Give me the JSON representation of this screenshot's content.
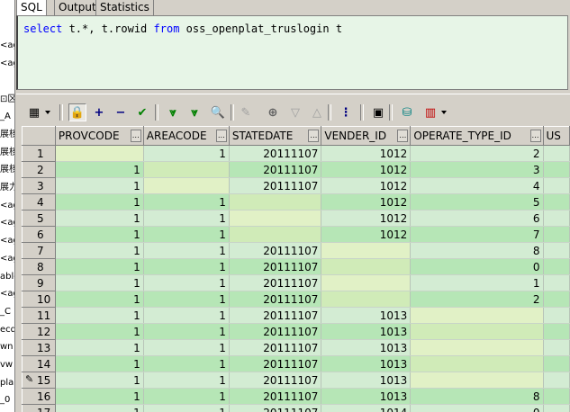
{
  "left_panel": {
    "items": [
      "",
      "",
      "<ag",
      "<ag",
      "",
      "⊡区",
      "_A",
      "展核",
      "展核",
      "展核",
      "展力",
      "<ag",
      "<ag",
      "<ag",
      "<ag",
      "able",
      "<ag",
      "_C",
      "ecd",
      "wn",
      "vw",
      "pla",
      "_0"
    ]
  },
  "tabs": [
    {
      "label": "SQL",
      "active": true
    },
    {
      "label": "Output",
      "active": false
    },
    {
      "label": "Statistics",
      "active": false
    }
  ],
  "editor": {
    "tokens": [
      {
        "text": "select",
        "kw": true
      },
      {
        "text": " t.*, t.rowid ",
        "kw": false
      },
      {
        "text": "from",
        "kw": true
      },
      {
        "text": " oss_openplat_truslogin t",
        "kw": false
      }
    ]
  },
  "toolbar": {
    "buttons": [
      {
        "icon": "grid-select-icon",
        "glyph": "▦",
        "color": "#000000",
        "dropdown": true
      },
      {
        "icon": "lock-icon",
        "glyph": "🔒",
        "color": "#806000",
        "pressed": true
      },
      {
        "icon": "insert-record-icon",
        "glyph": "+",
        "color": "#000080"
      },
      {
        "icon": "delete-record-icon",
        "glyph": "−",
        "color": "#000080"
      },
      {
        "icon": "post-changes-icon",
        "glyph": "✔",
        "color": "#008000"
      },
      {
        "icon": "fetch-next-icon",
        "glyph": "⩔",
        "color": "#008000"
      },
      {
        "icon": "fetch-last-icon",
        "glyph": "⩔",
        "color": "#008000"
      },
      {
        "icon": "find-icon",
        "glyph": "🔍",
        "color": "#000000"
      },
      {
        "icon": "clear-icon",
        "glyph": "✎",
        "color": "#a0a0a0"
      },
      {
        "icon": "query-by-example-icon",
        "glyph": "⊕",
        "color": "#606060"
      },
      {
        "icon": "sort-down-icon",
        "glyph": "▽",
        "color": "#a0a0a0"
      },
      {
        "icon": "sort-up-icon",
        "glyph": "△",
        "color": "#a0a0a0"
      },
      {
        "icon": "tree-view-icon",
        "glyph": "⋮",
        "color": "#000080"
      },
      {
        "icon": "save-icon",
        "glyph": "▣",
        "color": "#000000"
      },
      {
        "icon": "database-icon",
        "glyph": "⛁",
        "color": "#008080"
      },
      {
        "icon": "chart-icon",
        "glyph": "▥",
        "color": "#c00000",
        "dropdown": true
      }
    ]
  },
  "grid": {
    "columns": [
      "PROVCODE",
      "AREACODE",
      "STATEDATE",
      "VENDER_ID",
      "OPERATE_TYPE_ID",
      "US"
    ],
    "rows": [
      {
        "n": "1",
        "cells": [
          "",
          "1",
          "20111107",
          "1012",
          "2",
          ""
        ]
      },
      {
        "n": "2",
        "cells": [
          "1",
          "",
          "20111107",
          "1012",
          "3",
          ""
        ]
      },
      {
        "n": "3",
        "cells": [
          "1",
          "",
          "20111107",
          "1012",
          "4",
          ""
        ]
      },
      {
        "n": "4",
        "cells": [
          "1",
          "1",
          "",
          "1012",
          "5",
          ""
        ]
      },
      {
        "n": "5",
        "cells": [
          "1",
          "1",
          "",
          "1012",
          "6",
          ""
        ]
      },
      {
        "n": "6",
        "cells": [
          "1",
          "1",
          "",
          "1012",
          "7",
          ""
        ]
      },
      {
        "n": "7",
        "cells": [
          "1",
          "1",
          "20111107",
          "",
          "8",
          ""
        ]
      },
      {
        "n": "8",
        "cells": [
          "1",
          "1",
          "20111107",
          "",
          "0",
          ""
        ]
      },
      {
        "n": "9",
        "cells": [
          "1",
          "1",
          "20111107",
          "",
          "1",
          ""
        ]
      },
      {
        "n": "10",
        "cells": [
          "1",
          "1",
          "20111107",
          "",
          "2",
          ""
        ]
      },
      {
        "n": "11",
        "cells": [
          "1",
          "1",
          "20111107",
          "1013",
          "",
          ""
        ]
      },
      {
        "n": "12",
        "cells": [
          "1",
          "1",
          "20111107",
          "1013",
          "",
          ""
        ]
      },
      {
        "n": "13",
        "cells": [
          "1",
          "1",
          "20111107",
          "1013",
          "",
          ""
        ]
      },
      {
        "n": "14",
        "cells": [
          "1",
          "1",
          "20111107",
          "1013",
          "",
          ""
        ]
      },
      {
        "n": "15",
        "cells": [
          "1",
          "1",
          "20111107",
          "1013",
          "",
          ""
        ],
        "editing": true
      },
      {
        "n": "16",
        "cells": [
          "1",
          "1",
          "20111107",
          "1013",
          "8",
          ""
        ]
      },
      {
        "n": "17",
        "cells": [
          "1",
          "1",
          "20111107",
          "1014",
          "0",
          ""
        ]
      }
    ]
  }
}
